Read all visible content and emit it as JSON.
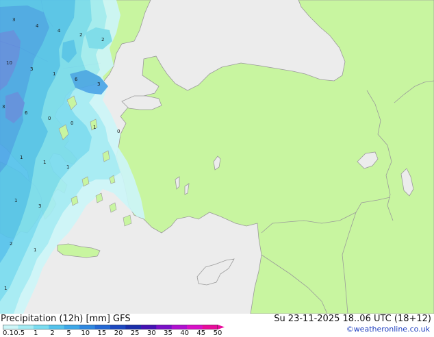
{
  "header": {
    "title": "Precipitation (12h) [mm] GFS",
    "timestamp": "Su 23-11-2025 18..06 UTC (18+12)",
    "credit": "©weatheronline.co.uk"
  },
  "colors": {
    "sea": "#ececec",
    "land": "#c8f5a0",
    "coast": "#9a9a9a",
    "precip_0_1": "#cdf6f8",
    "precip_0_5": "#a4ecf4",
    "precip_1": "#7adcf0",
    "precip_2": "#55c3ec",
    "precip_5": "#4aa6e8",
    "precip_10": "#5e8ce2"
  },
  "legend": {
    "ticks": [
      "0.1",
      "0.5",
      "1",
      "2",
      "5",
      "10",
      "15",
      "20",
      "25",
      "30",
      "35",
      "40",
      "45",
      "50"
    ],
    "colors": [
      "#cdf6f8",
      "#a4ecf4",
      "#7adcf0",
      "#55c3ec",
      "#3ea8e8",
      "#2f88e0",
      "#2468d4",
      "#1c48c0",
      "#1a2eaa",
      "#4412b4",
      "#7a10c8",
      "#b010d0",
      "#d810c8",
      "#e80c9c"
    ]
  },
  "map_labels": [
    {
      "text": "3"
    },
    {
      "text": "4"
    },
    {
      "text": "4"
    },
    {
      "text": "2"
    },
    {
      "text": "2"
    },
    {
      "text": "10"
    },
    {
      "text": "3"
    },
    {
      "text": "1"
    },
    {
      "text": "6"
    },
    {
      "text": "3"
    },
    {
      "text": "3"
    },
    {
      "text": "6"
    },
    {
      "text": "0"
    },
    {
      "text": "0"
    },
    {
      "text": "1"
    },
    {
      "text": "0"
    },
    {
      "text": "1"
    },
    {
      "text": "1"
    },
    {
      "text": "1"
    },
    {
      "text": "1"
    },
    {
      "text": "3"
    },
    {
      "text": "2"
    },
    {
      "text": "1"
    },
    {
      "text": "1"
    }
  ]
}
